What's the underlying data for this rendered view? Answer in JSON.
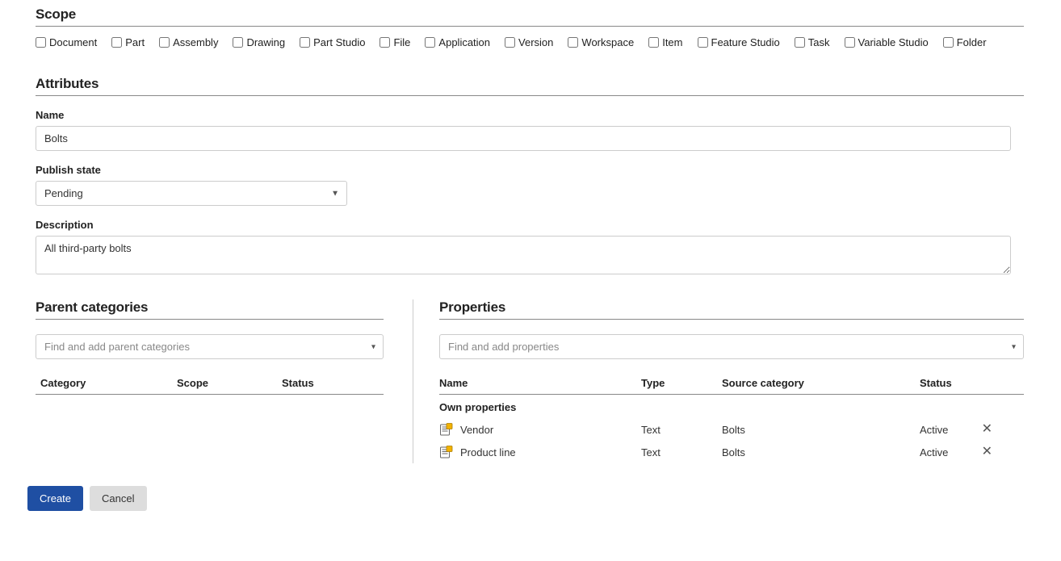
{
  "scope": {
    "heading": "Scope",
    "items": [
      {
        "label": "Document",
        "checked": false
      },
      {
        "label": "Part",
        "checked": false
      },
      {
        "label": "Assembly",
        "checked": false
      },
      {
        "label": "Drawing",
        "checked": false
      },
      {
        "label": "Part Studio",
        "checked": false
      },
      {
        "label": "File",
        "checked": false
      },
      {
        "label": "Application",
        "checked": false
      },
      {
        "label": "Version",
        "checked": false
      },
      {
        "label": "Workspace",
        "checked": false
      },
      {
        "label": "Item",
        "checked": false
      },
      {
        "label": "Feature Studio",
        "checked": false
      },
      {
        "label": "Task",
        "checked": false
      },
      {
        "label": "Variable Studio",
        "checked": false
      },
      {
        "label": "Folder",
        "checked": false
      }
    ]
  },
  "attributes": {
    "heading": "Attributes",
    "name_label": "Name",
    "name_value": "Bolts",
    "publish_label": "Publish state",
    "publish_value": "Pending",
    "description_label": "Description",
    "description_value": "All third-party bolts"
  },
  "parent_categories": {
    "heading": "Parent categories",
    "search_placeholder": "Find and add parent categories",
    "columns": {
      "category": "Category",
      "scope": "Scope",
      "status": "Status"
    }
  },
  "properties": {
    "heading": "Properties",
    "search_placeholder": "Find and add properties",
    "columns": {
      "name": "Name",
      "type": "Type",
      "source": "Source category",
      "status": "Status"
    },
    "own_heading": "Own properties",
    "rows": [
      {
        "name": "Vendor",
        "type": "Text",
        "source": "Bolts",
        "status": "Active"
      },
      {
        "name": "Product line",
        "type": "Text",
        "source": "Bolts",
        "status": "Active"
      }
    ]
  },
  "footer": {
    "create": "Create",
    "cancel": "Cancel"
  }
}
